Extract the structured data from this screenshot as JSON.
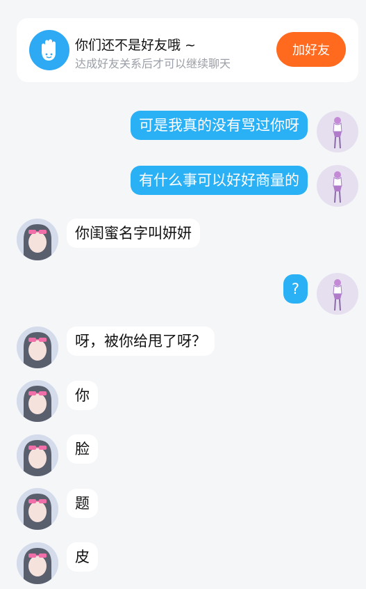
{
  "banner": {
    "icon": "hand-wave-icon",
    "title": "你们还不是好友哦 ~",
    "subtitle": "达成好友关系后才可以继续聊天",
    "button_label": "加好友"
  },
  "colors": {
    "accent_blue": "#2ab0f4",
    "button_orange": "#ff6a1f",
    "background": "#f5f6f8"
  },
  "messages": [
    {
      "sender": "self",
      "text": "可是我真的没有骂过你呀"
    },
    {
      "sender": "self",
      "text": "有什么事可以好好商量的"
    },
    {
      "sender": "other",
      "text": "你闺蜜名字叫妍妍"
    },
    {
      "sender": "self",
      "text": "?"
    },
    {
      "sender": "other",
      "text": "呀，被你给甩了呀？"
    },
    {
      "sender": "other",
      "text": "你"
    },
    {
      "sender": "other",
      "text": "脸"
    },
    {
      "sender": "other",
      "text": "题"
    },
    {
      "sender": "other",
      "text": "皮"
    }
  ]
}
